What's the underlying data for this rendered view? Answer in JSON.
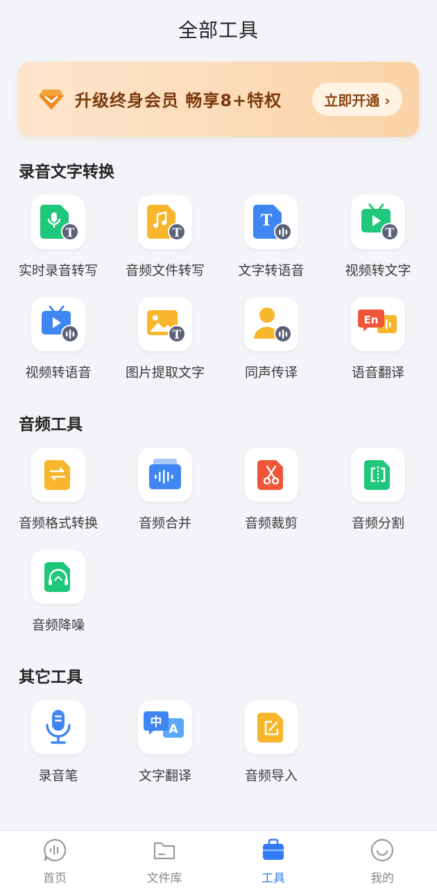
{
  "header": {
    "title": "全部工具"
  },
  "banner": {
    "text": "升级终身会员 畅享8+特权",
    "button_label": "立即开通 ›"
  },
  "sections": [
    {
      "title": "录音文字转换",
      "tools": [
        "实时录音转写",
        "音频文件转写",
        "文字转语音",
        "视频转文字",
        "视频转语音",
        "图片提取文字",
        "同声传译",
        "语音翻译"
      ]
    },
    {
      "title": "音频工具",
      "tools": [
        "音频格式转换",
        "音频合并",
        "音频裁剪",
        "音频分割",
        "音频降噪"
      ]
    },
    {
      "title": "其它工具",
      "tools": [
        "录音笔",
        "文字翻译",
        "音频导入"
      ]
    }
  ],
  "icon_glyphs": {
    "translate_zh": "中",
    "translate_en": "A",
    "speech_en": "En",
    "doc_t": "T"
  },
  "bottom_nav": [
    {
      "label": "首页",
      "icon": "home-waveform-icon"
    },
    {
      "label": "文件库",
      "icon": "folder-icon"
    },
    {
      "label": "工具",
      "icon": "toolbox-icon",
      "active": true
    },
    {
      "label": "我的",
      "icon": "profile-smile-icon"
    }
  ],
  "colors": {
    "accent": "#2f7cf6",
    "banner_text": "#7a3a0c",
    "background": "#f3f4f8"
  }
}
